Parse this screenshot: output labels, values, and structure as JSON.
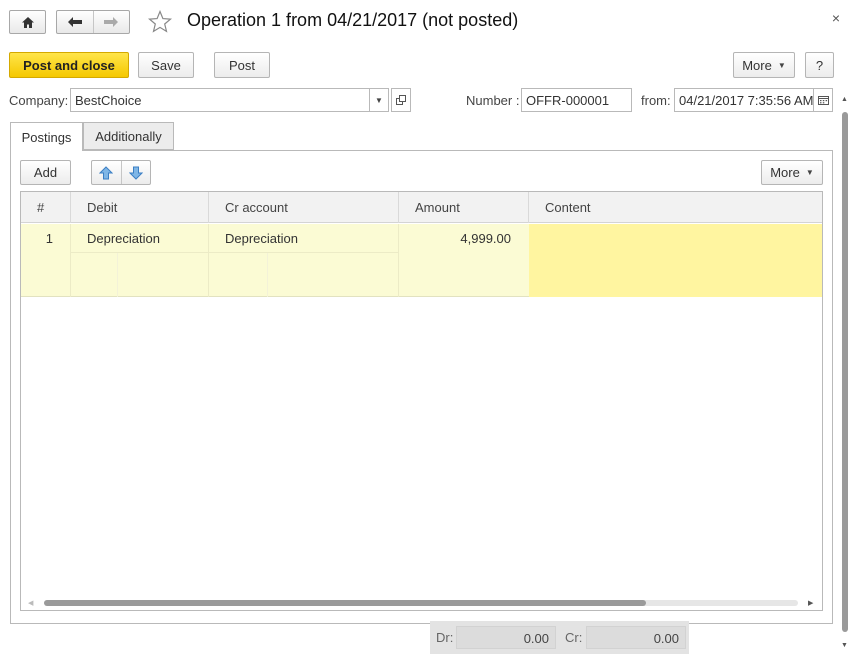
{
  "window": {
    "title": "Operation 1 from 04/21/2017 (not posted)",
    "close_glyph": "×"
  },
  "toolbar": {
    "post_and_close_label": "Post and close",
    "save_label": "Save",
    "post_label": "Post",
    "more_label": "More",
    "help_label": "?"
  },
  "header": {
    "company_label": "Company:",
    "company_value": "BestChoice",
    "number_label": "Number :",
    "number_value": "OFFR-000001",
    "from_label": "from:",
    "date_value": "04/21/2017  7:35:56 AM"
  },
  "tabs": [
    {
      "label": "Postings",
      "active": true
    },
    {
      "label": "Additionally",
      "active": false
    }
  ],
  "table_toolbar": {
    "add_label": "Add",
    "more_label": "More"
  },
  "table": {
    "columns": [
      "#",
      "Debit",
      "Cr account",
      "Amount",
      "Content"
    ],
    "rows": [
      {
        "num": "1",
        "debit": "Depreciation",
        "cr_account": "Depreciation",
        "amount": "4,999.00",
        "content": ""
      }
    ]
  },
  "totals": {
    "dr_label": "Dr:",
    "dr_value": "0.00",
    "cr_label": "Cr:",
    "cr_value": "0.00"
  },
  "colors": {
    "primary_button": "#f5c800",
    "row_highlight": "#fbfbd4",
    "content_cell_highlight": "#fff5a0"
  }
}
